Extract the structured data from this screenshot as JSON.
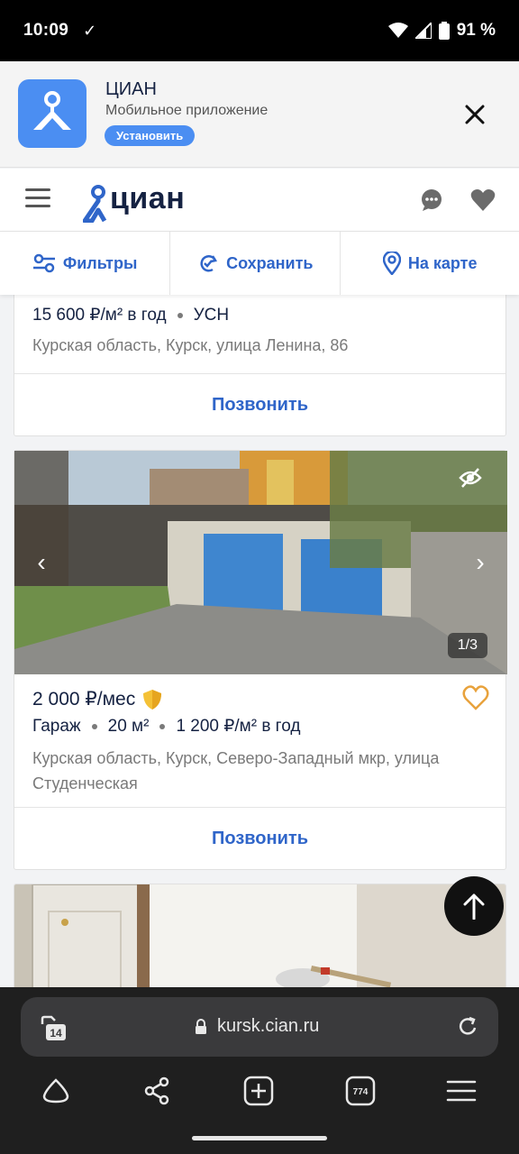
{
  "status_bar": {
    "time": "10:09",
    "battery": "91 %"
  },
  "app_banner": {
    "title": "ЦИАН",
    "subtitle": "Мобильное приложение",
    "install_label": "Установить"
  },
  "header": {
    "logo_text": "циан"
  },
  "filter_bar": {
    "filters_label": "Фильтры",
    "save_label": "Сохранить",
    "map_label": "На карте"
  },
  "listings": [
    {
      "price_line": "15 600 ₽/м² в год",
      "tax": "УСН",
      "address": "Курская область, Курск, улица Ленина, 86",
      "call_label": "Позвонить"
    },
    {
      "price": "2 000 ₽/мес",
      "type": "Гараж",
      "area": "20 м²",
      "price_per_m2": "1 200 ₽/м² в год",
      "address": "Курская область, Курск, Северо-Западный мкр, улица Студенческая",
      "photo_counter": "1/3",
      "call_label": "Позвонить"
    }
  ],
  "browser": {
    "url": "kursk.cian.ru",
    "tab_count": "774",
    "tab_badge": "14"
  },
  "colors": {
    "accent": "#2f65c9",
    "brand": "#4b8ef2",
    "favorite": "#e8a23c"
  }
}
